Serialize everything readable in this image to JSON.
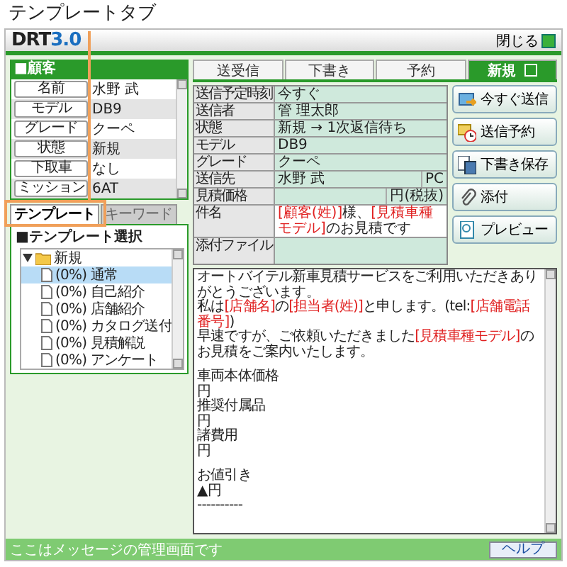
{
  "annotation": {
    "caption": "テンプレートタブ"
  },
  "window": {
    "logo_main": "DRT",
    "logo_version": "3.0",
    "close_label": "閉じる"
  },
  "customer": {
    "title": "■顧客",
    "rows": [
      {
        "label": "名前",
        "value": "水野 武"
      },
      {
        "label": "モデル",
        "value": "DB9"
      },
      {
        "label": "グレード",
        "value": "クーペ"
      },
      {
        "label": "状態",
        "value": "新規"
      },
      {
        "label": "下取車",
        "value": "なし"
      },
      {
        "label": "ミッション",
        "value": "6AT"
      }
    ]
  },
  "left_tabs": [
    {
      "label": "テンプレート",
      "selected": true
    },
    {
      "label": "キーワード",
      "selected": false
    }
  ],
  "template": {
    "title": "■テンプレート選択",
    "tree": [
      {
        "label": "新規",
        "expanded": true,
        "children": [
          {
            "label": "(0%) 通常",
            "selected": true
          },
          {
            "label": "(0%) 自己紹介",
            "selected": false
          },
          {
            "label": "(0%) 店舗紹介",
            "selected": false
          },
          {
            "label": "(0%) カタログ送付",
            "selected": false
          },
          {
            "label": "(0%) 見積解説",
            "selected": false
          },
          {
            "label": "(0%) アンケート",
            "selected": false
          }
        ]
      }
    ]
  },
  "tabs": [
    {
      "label": "送受信",
      "selected": false
    },
    {
      "label": "下書き",
      "selected": false
    },
    {
      "label": "予約",
      "selected": false
    },
    {
      "label": "新規",
      "selected": true
    }
  ],
  "form": [
    {
      "label": "送信予定時刻",
      "value": [
        {
          "text": "今すぐ",
          "kind": "text"
        }
      ]
    },
    {
      "label": "送信者",
      "value": [
        {
          "text": "管 理太郎",
          "kind": "text"
        }
      ]
    },
    {
      "label": "状態",
      "value": [
        {
          "text": "新規 → 1次返信待ち",
          "kind": "text"
        }
      ]
    },
    {
      "label": "モデル",
      "value": [
        {
          "text": "DB9",
          "kind": "text"
        }
      ]
    },
    {
      "label": "グレード",
      "value": [
        {
          "text": "クーペ",
          "kind": "text"
        }
      ]
    },
    {
      "label": "送信先",
      "value": [
        {
          "text": "水野 武",
          "kind": "text"
        }
      ],
      "suffix": "PC"
    },
    {
      "label": "見積価格",
      "suffix": "円(税抜)"
    },
    {
      "label": "件名",
      "editable": true,
      "value": [
        {
          "text": "[顧客(姓)]",
          "kind": "tag"
        },
        {
          "text": "様、",
          "kind": "text"
        },
        {
          "text": "[見積車種モデル]",
          "kind": "tag"
        },
        {
          "text": "のお見積です",
          "kind": "text"
        }
      ]
    },
    {
      "label": "添付ファイル"
    }
  ],
  "actions": [
    {
      "label": "今すぐ送信",
      "kind": "send"
    },
    {
      "label": "送信予約",
      "kind": "schedule"
    },
    {
      "label": "下書き保存",
      "kind": "save"
    },
    {
      "label": "添付",
      "kind": "attach"
    },
    {
      "label": "プレビュー",
      "kind": "preview"
    }
  ],
  "body": [
    [
      [
        {
          "text": "オートバイテル新車見積サービスをご利用いただきありがとうございます。",
          "kind": "text"
        }
      ],
      [
        {
          "text": "私は",
          "kind": "text"
        },
        {
          "text": "[店舗名]",
          "kind": "tag"
        },
        {
          "text": "の",
          "kind": "text"
        },
        {
          "text": "[担当者(姓)]",
          "kind": "tag"
        },
        {
          "text": "と申します。(tel:",
          "kind": "text"
        },
        {
          "text": "[店舗電話番号]",
          "kind": "tag"
        },
        {
          "text": ")",
          "kind": "text"
        }
      ],
      [
        {
          "text": "早速ですが、ご依頼いただきました",
          "kind": "text"
        },
        {
          "text": "[見積車種モデル]",
          "kind": "tag"
        },
        {
          "text": "のお見積をご案内いたします。",
          "kind": "text"
        }
      ]
    ],
    [
      [
        {
          "text": "車両本体価格",
          "kind": "text"
        }
      ],
      [
        {
          "text": "円",
          "kind": "text"
        }
      ],
      [
        {
          "text": "推奨付属品",
          "kind": "text"
        }
      ],
      [
        {
          "text": "円",
          "kind": "text"
        }
      ],
      [
        {
          "text": "諸費用",
          "kind": "text"
        }
      ],
      [
        {
          "text": "円",
          "kind": "text"
        }
      ]
    ],
    [
      [
        {
          "text": "お値引き",
          "kind": "text"
        }
      ],
      [
        {
          "text": "▲円",
          "kind": "text"
        }
      ],
      [
        {
          "text": "----------",
          "kind": "text"
        }
      ]
    ]
  ],
  "status_bar": {
    "message": "ここはメッセージの管理画面です",
    "help": "ヘルプ"
  }
}
